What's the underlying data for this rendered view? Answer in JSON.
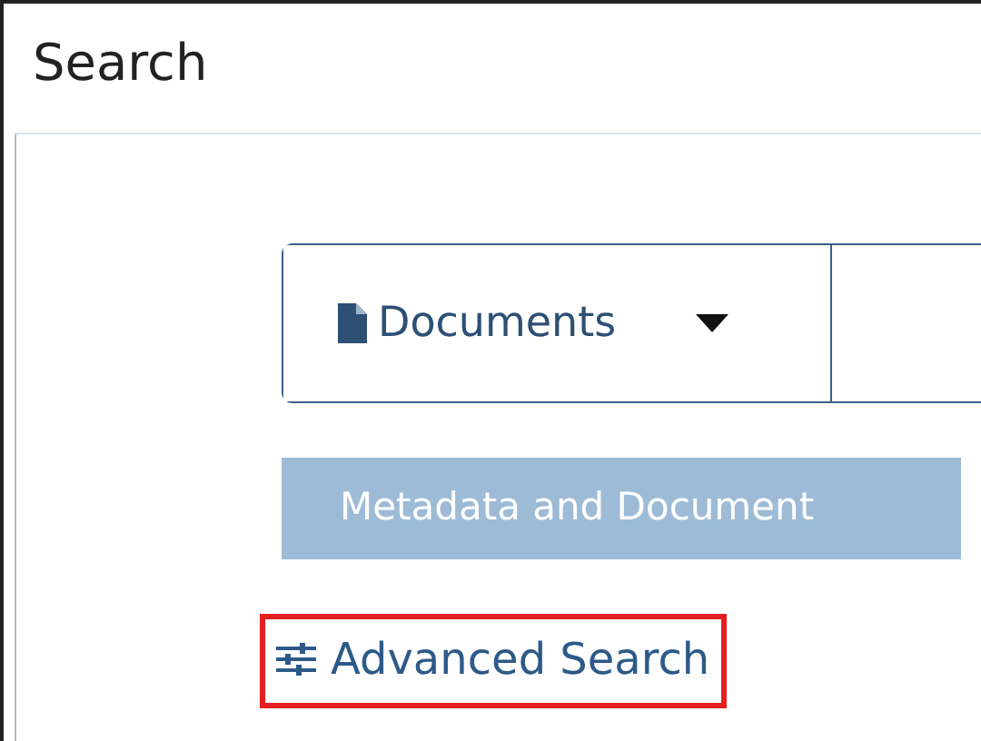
{
  "title": "Search",
  "search_type": {
    "label": "Documents"
  },
  "scope_tab": {
    "label": "Metadata and Document",
    "selected": true
  },
  "advanced_link": {
    "label": "Advanced Search",
    "highlighted": true
  }
}
